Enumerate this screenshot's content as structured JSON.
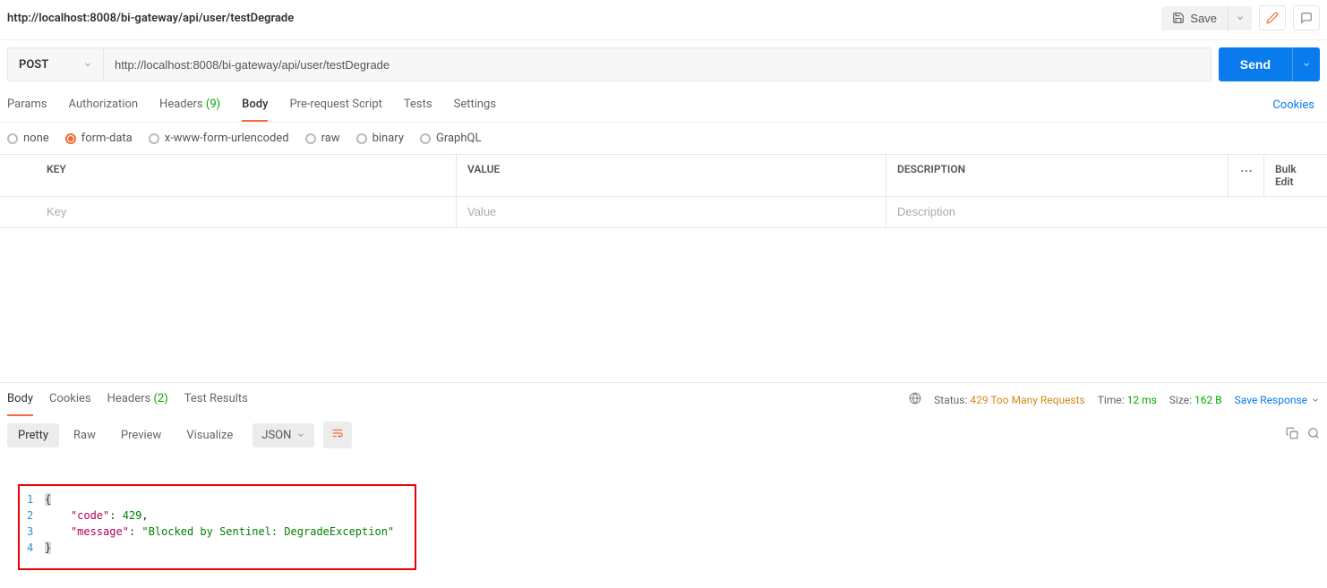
{
  "topbar": {
    "title": "http://localhost:8008/bi-gateway/api/user/testDegrade",
    "save_label": "Save"
  },
  "request": {
    "method": "POST",
    "url": "http://localhost:8008/bi-gateway/api/user/testDegrade",
    "send_label": "Send",
    "tabs": {
      "params": "Params",
      "authorization": "Authorization",
      "headers": "Headers",
      "headers_count": "(9)",
      "body": "Body",
      "prerequest": "Pre-request Script",
      "tests": "Tests",
      "settings": "Settings"
    },
    "cookies_link": "Cookies",
    "body_types": {
      "none": "none",
      "form_data": "form-data",
      "x_www": "x-www-form-urlencoded",
      "raw": "raw",
      "binary": "binary",
      "graphql": "GraphQL"
    },
    "kv": {
      "key_header": "KEY",
      "value_header": "VALUE",
      "desc_header": "DESCRIPTION",
      "bulk_edit": "Bulk Edit",
      "key_placeholder": "Key",
      "value_placeholder": "Value",
      "desc_placeholder": "Description"
    }
  },
  "response": {
    "tabs": {
      "body": "Body",
      "cookies": "Cookies",
      "headers": "Headers",
      "headers_count": "(2)",
      "test_results": "Test Results"
    },
    "meta": {
      "status_label": "Status:",
      "status_value": "429 Too Many Requests",
      "time_label": "Time:",
      "time_value": "12 ms",
      "size_label": "Size:",
      "size_value": "162 B"
    },
    "save_response": "Save Response",
    "view_tabs": {
      "pretty": "Pretty",
      "raw": "Raw",
      "preview": "Preview",
      "visualize": "Visualize"
    },
    "format": "JSON",
    "body_lines": {
      "l1": "{",
      "l2_key": "\"code\"",
      "l2_sep": ": ",
      "l2_val": "429",
      "l2_comma": ",",
      "l3_key": "\"message\"",
      "l3_sep": ": ",
      "l3_val": "\"Blocked by Sentinel: DegradeException\"",
      "l4": "}"
    }
  }
}
